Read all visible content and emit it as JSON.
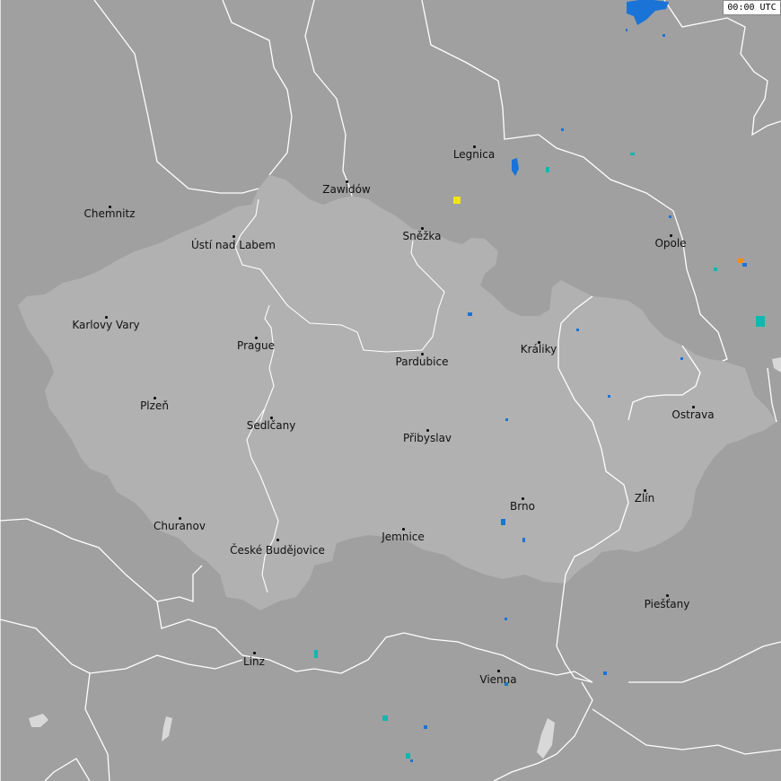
{
  "map": {
    "timestamp": "00:00 UTC",
    "colors": {
      "background": "#a0a0a0",
      "country_fill": "#b1b1b1",
      "borders": "#ffffff",
      "lakes": "#d8d8d8",
      "strike_blue": "#1a74d8",
      "strike_cyan": "#10b7b0",
      "strike_yellow": "#f2e21a",
      "strike_orange": "#f28c1a"
    },
    "cities": [
      {
        "id": "chemnitz",
        "name": "Chemnitz"
      },
      {
        "id": "zawidow",
        "name": "Zawidów"
      },
      {
        "id": "legnica",
        "name": "Legnica"
      },
      {
        "id": "usti",
        "name": "Ústí nad Labem"
      },
      {
        "id": "snezka",
        "name": "Sněžka"
      },
      {
        "id": "opole",
        "name": "Opole"
      },
      {
        "id": "karlovy-vary",
        "name": "Karlovy Vary"
      },
      {
        "id": "prague",
        "name": "Prague"
      },
      {
        "id": "pardubice",
        "name": "Pardubice"
      },
      {
        "id": "kraliky",
        "name": "Králiky"
      },
      {
        "id": "plzen",
        "name": "Plzeň"
      },
      {
        "id": "sedlcany",
        "name": "Sedlčany"
      },
      {
        "id": "pribyslav",
        "name": "Přibyslav"
      },
      {
        "id": "ostrava",
        "name": "Ostrava"
      },
      {
        "id": "brno",
        "name": "Brno"
      },
      {
        "id": "zlin",
        "name": "Zlín"
      },
      {
        "id": "churanov",
        "name": "Churanov"
      },
      {
        "id": "ceske-budejovice",
        "name": "České Budějovice"
      },
      {
        "id": "jemnice",
        "name": "Jemnice"
      },
      {
        "id": "piestany",
        "name": "Piešťany"
      },
      {
        "id": "linz",
        "name": "Linz"
      },
      {
        "id": "vienna",
        "name": "Vienna"
      }
    ]
  }
}
